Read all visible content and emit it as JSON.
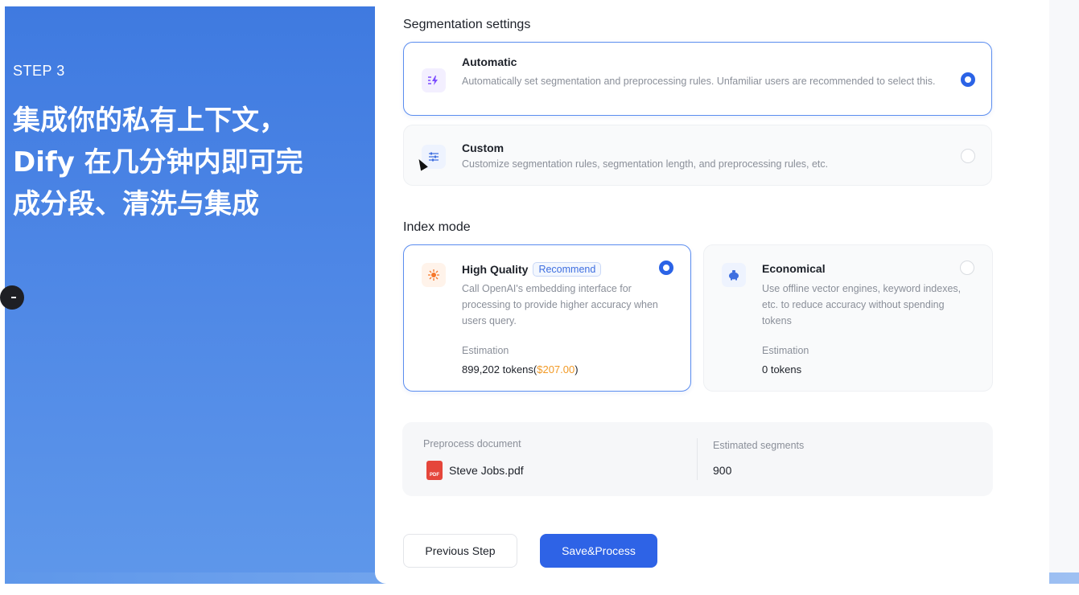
{
  "colors": {
    "accent": "#2e63e6",
    "panel_gradient_top": "#3f7ae0",
    "panel_gradient_bottom": "#5e97ea",
    "cost_color": "#f29a26",
    "pdf_red": "#e5463b"
  },
  "hero": {
    "step": "STEP 3",
    "title_lines": [
      "集成你的私有上下文，",
      "Dify 在几分钟内即可完",
      "成分段、清洗与集成"
    ]
  },
  "segmentation": {
    "title": "Segmentation settings",
    "options": [
      {
        "id": "automatic",
        "title": "Automatic",
        "description": "Automatically set segmentation and preprocessing rules. Unfamiliar users are recommended to select this.",
        "icon": "lightning-icon",
        "selected": true
      },
      {
        "id": "custom",
        "title": "Custom",
        "description": "Customize segmentation rules, segmentation length, and preprocessing rules, etc.",
        "icon": "sliders-icon",
        "selected": false
      }
    ]
  },
  "index_mode": {
    "title": "Index mode",
    "options": [
      {
        "id": "high-quality",
        "title": "High Quality",
        "badge": "Recommend",
        "description": "Call OpenAI's embedding interface for processing to provide higher accuracy when users query.",
        "estimation_label": "Estimation",
        "tokens": "899,202 tokens(",
        "cost": "$207.00",
        "tokens_suffix": ")",
        "icon": "sparkle-icon",
        "selected": true
      },
      {
        "id": "economical",
        "title": "Economical",
        "description": "Use offline vector engines, keyword indexes, etc. to reduce accuracy without spending tokens",
        "estimation_label": "Estimation",
        "tokens": "0 tokens",
        "icon": "piggy-bank-icon",
        "selected": false
      }
    ]
  },
  "preprocess": {
    "doc_label": "Preprocess document",
    "file_name": "Steve Jobs.pdf",
    "file_icon": "pdf-file-icon",
    "pdf_badge": "PDF",
    "segments_label": "Estimated segments",
    "segments_value": "900"
  },
  "actions": {
    "previous": "Previous Step",
    "save": "Save&Process"
  }
}
